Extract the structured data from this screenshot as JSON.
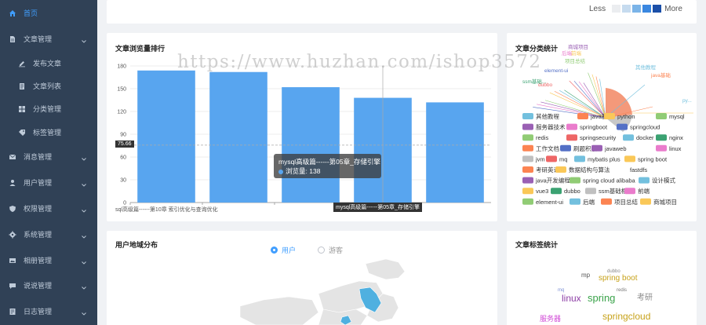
{
  "sidebar": {
    "items": [
      {
        "label": "首页",
        "icon": "home-icon",
        "active": true,
        "has_children": false
      },
      {
        "label": "文章管理",
        "icon": "document-icon",
        "has_children": true
      },
      {
        "label": "发布文章",
        "icon": "edit-icon",
        "sub": true
      },
      {
        "label": "文章列表",
        "icon": "list-icon",
        "sub": true
      },
      {
        "label": "分类管理",
        "icon": "category-icon",
        "sub": true
      },
      {
        "label": "标签管理",
        "icon": "tag-icon",
        "sub": true
      },
      {
        "label": "消息管理",
        "icon": "mail-icon",
        "has_children": true
      },
      {
        "label": "用户管理",
        "icon": "user-icon",
        "has_children": true
      },
      {
        "label": "权限管理",
        "icon": "shield-icon",
        "has_children": true
      },
      {
        "label": "系统管理",
        "icon": "gear-icon",
        "has_children": true
      },
      {
        "label": "相册管理",
        "icon": "image-icon",
        "has_children": true
      },
      {
        "label": "说说管理",
        "icon": "chat-icon",
        "has_children": true
      },
      {
        "label": "日志管理",
        "icon": "log-icon",
        "has_children": true
      }
    ]
  },
  "heatmap_legend": {
    "less": "Less",
    "more": "More",
    "colors": [
      "#ebedf0",
      "#c6dbef",
      "#7bb4e8",
      "#3a87e0",
      "#1b4fa8"
    ]
  },
  "watermark": "https://www.huzhan.com/ishop3572",
  "article_rank": {
    "title": "文章浏览量排行",
    "chart_data": {
      "type": "bar",
      "ylim": [
        0,
        180
      ],
      "yticks": [
        0,
        30,
        60,
        90,
        120,
        150,
        180
      ],
      "values": [
        174,
        172,
        152,
        138,
        132
      ],
      "first_category_label": "sql高级篇------第10章 索引优化与查询优化",
      "color": "#58a5ef",
      "axis_pointer_value": "75.66",
      "axis_pointer_x_label": "mysql高级篇------第05章_存储引擎"
    },
    "tooltip": {
      "title": "mysql高级篇------第05章_存储引擎",
      "series": "浏览量",
      "value": "138"
    }
  },
  "category_stats": {
    "title": "文章分类统计",
    "legend": [
      [
        "其他教程",
        "java基础",
        "python",
        "mysql"
      ],
      [
        "服务器技术",
        "springboot",
        "springcloud"
      ],
      [
        "redis",
        "springsecurity",
        "docker",
        "nginx"
      ],
      [
        "工作文档",
        "刷题积累",
        "javaweb",
        "linux"
      ],
      [
        "jvm",
        "mq",
        "mybatis plus",
        "spring boot"
      ],
      [
        "考研英语",
        "数据结构与算法",
        "fastdfs"
      ],
      [
        "java开发编程",
        "spring cloud alibaba",
        "设计模式"
      ],
      [
        "vue3",
        "dubbo",
        "ssm基础框架",
        "前端"
      ],
      [
        "element-ui",
        "后端",
        "项目总结",
        "商城项目"
      ]
    ],
    "legend_colors": [
      [
        "#73c0de",
        "#fc8452",
        "#fac858",
        "#91cc75"
      ],
      [
        "#9a60b4",
        "#ea7ccc",
        "#5470c6"
      ],
      [
        "#91cc75",
        "#ee6666",
        "#73c0de",
        "#3ba272"
      ],
      [
        "#fc8452",
        "#5470c6",
        "#9a60b4",
        "#ea7ccc"
      ],
      [
        "#c0c0c0",
        "#ee6666",
        "#73c0de",
        "#fac858"
      ],
      [
        "#fc8452",
        "#fac858",
        "#ffffff"
      ],
      [
        "#9a60b4",
        "#91cc75",
        "#73c0de"
      ],
      [
        "#fac858",
        "#3ba272",
        "#c0c0c0",
        "#ea7ccc"
      ],
      [
        "#91cc75",
        "#73c0de",
        "#fc8452",
        "#fac858"
      ]
    ],
    "pie_labels": [
      "其他教程",
      "java基础",
      "前端",
      "项目总结",
      "商城项目",
      "后端",
      "element-ui",
      "dubbo",
      "ssm基础...",
      "py..."
    ]
  },
  "user_region": {
    "title": "用户地域分布",
    "options": [
      {
        "label": "用户",
        "selected": true
      },
      {
        "label": "游客",
        "selected": false
      }
    ]
  },
  "tag_stats": {
    "title": "文章标签统计",
    "words": [
      {
        "text": "mp",
        "color": "#555555",
        "size": 8
      },
      {
        "text": "dubbo",
        "color": "#888888",
        "size": 6
      },
      {
        "text": "spring boot",
        "color": "#c7a21a",
        "size": 10
      },
      {
        "text": "mq",
        "color": "#7b8fd4",
        "size": 6
      },
      {
        "text": "redis",
        "color": "#777777",
        "size": 6
      },
      {
        "text": "linux",
        "color": "#8e3fa6",
        "size": 12
      },
      {
        "text": "spring",
        "color": "#3aa34a",
        "size": 13
      },
      {
        "text": "考研",
        "color": "#8a8a8a",
        "size": 10
      },
      {
        "text": "服务器",
        "color": "#d04ad6",
        "size": 9
      },
      {
        "text": "springcloud",
        "color": "#c7a21a",
        "size": 12
      }
    ]
  }
}
